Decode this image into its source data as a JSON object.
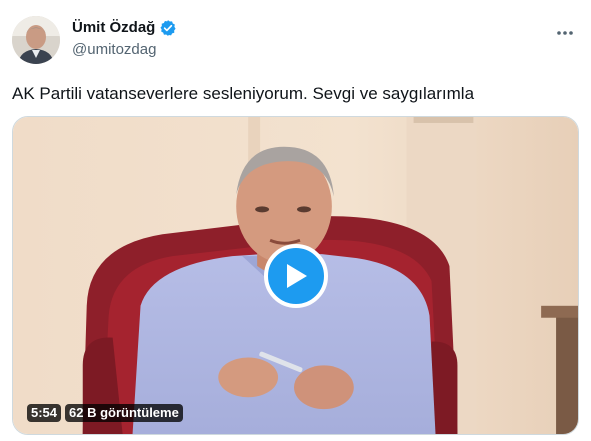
{
  "author": {
    "display_name": "Ümit Özdağ",
    "handle": "@umitozdag",
    "verified": true
  },
  "tweet": {
    "text": "AK Partili vatanseverlere sesleniyorum. Sevgi ve saygılarımla"
  },
  "video": {
    "duration": "5:54",
    "views": "62 B görüntüleme"
  },
  "icons": {
    "verified": "verified-badge-icon",
    "more": "more-horizontal-icon",
    "play": "play-icon"
  },
  "colors": {
    "accent": "#1d9bf0",
    "text_primary": "#0f1419",
    "text_secondary": "#536471"
  }
}
